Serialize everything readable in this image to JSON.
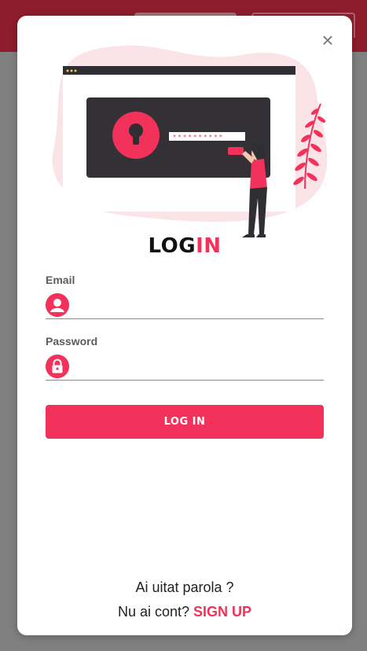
{
  "title": {
    "part1": "LOG",
    "part2": "IN"
  },
  "close_glyph": "×",
  "email": {
    "label": "Email",
    "value": "",
    "placeholder": ""
  },
  "password": {
    "label": "Password",
    "value": "",
    "placeholder": ""
  },
  "login_button": "LOG IN",
  "forgot_link": "Ai uitat parola ?",
  "signup": {
    "prompt": "Nu ai cont?",
    "link": "SIGN UP"
  },
  "colors": {
    "accent": "#f2325a",
    "header": "#8e1d2c",
    "overlay": "#808080"
  },
  "icons": {
    "close": "close-icon",
    "email": "user-icon",
    "password": "lock-icon"
  }
}
